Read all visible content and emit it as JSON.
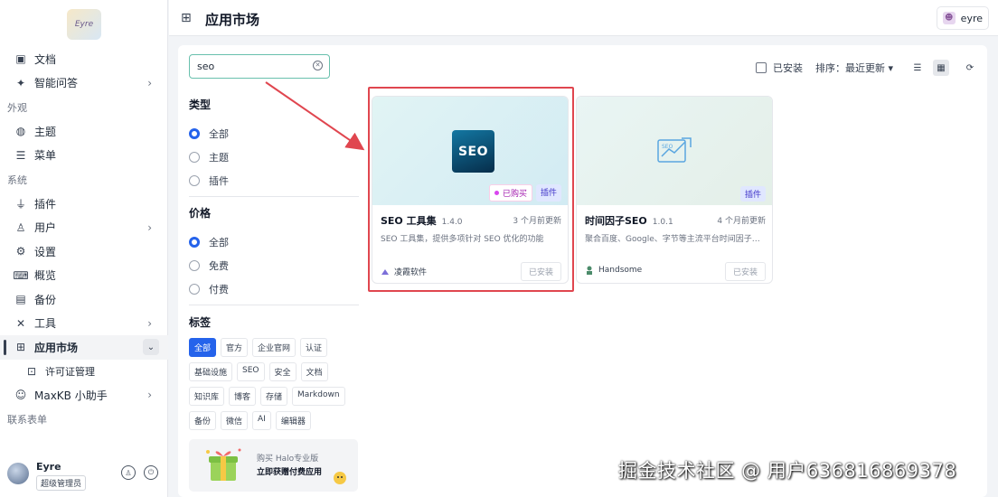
{
  "sidebar": {
    "logo_text": "Eyre",
    "items": [
      {
        "label": "文档",
        "icon": "doc-icon"
      },
      {
        "label": "智能问答",
        "icon": "sparkle-icon",
        "arrow": true
      }
    ],
    "group_appearance": "外观",
    "appearance_items": [
      {
        "label": "主题",
        "icon": "palette-icon"
      },
      {
        "label": "菜单",
        "icon": "menu-icon"
      }
    ],
    "group_system": "系统",
    "system_items": [
      {
        "label": "插件",
        "icon": "plug-icon"
      },
      {
        "label": "用户",
        "icon": "user-icon",
        "arrow": true
      },
      {
        "label": "设置",
        "icon": "gear-icon"
      },
      {
        "label": "概览",
        "icon": "terminal-icon"
      },
      {
        "label": "备份",
        "icon": "backup-icon"
      },
      {
        "label": "工具",
        "icon": "tools-icon",
        "arrow": true
      },
      {
        "label": "应用市场",
        "icon": "apps-icon",
        "active": true
      },
      {
        "label": "许可证管理",
        "icon": "license-icon",
        "sub": true
      },
      {
        "label": "MaxKB 小助手",
        "icon": "bot-icon",
        "arrow": true
      }
    ],
    "group_forms": "联系表单",
    "user": {
      "name": "Eyre",
      "role": "超级管理员"
    }
  },
  "header": {
    "title": "应用市场",
    "account": "eyre"
  },
  "search": {
    "value": "seo"
  },
  "filters": {
    "type": {
      "title": "类型",
      "options": [
        "全部",
        "主题",
        "插件"
      ],
      "selected": "全部"
    },
    "price": {
      "title": "价格",
      "options": [
        "全部",
        "免费",
        "付费"
      ],
      "selected": "全部"
    },
    "tags": {
      "title": "标签",
      "items": [
        "全部",
        "官方",
        "企业官网",
        "认证",
        "基础设施",
        "SEO",
        "安全",
        "文档",
        "知识库",
        "博客",
        "存储",
        "Markdown",
        "备份",
        "微信",
        "AI",
        "编辑器"
      ],
      "selected": "全部"
    }
  },
  "promo": {
    "line1": "购买 Halo专业版",
    "line2": "立即获赠付费应用"
  },
  "toolbar": {
    "installed_label": "已安装",
    "sort_label": "排序：最近更新"
  },
  "cards": [
    {
      "name": "SEO 工具集",
      "version": "1.4.0",
      "updated": "3 个月前更新",
      "desc": "SEO 工具集，提供多项针对 SEO 优化的功能",
      "author": "凌霞软件",
      "install": "已安装",
      "bought": "已购买",
      "type": "插件",
      "logo": "SEO"
    },
    {
      "name": "时间因子SEO",
      "version": "1.0.1",
      "updated": "4 个月前更新",
      "desc": "聚合百度、Google、字节等主流平台时间因子和元...",
      "author": "Handsome",
      "install": "已安装",
      "type": "插件"
    }
  ],
  "watermark": "掘金技术社区 @ 用户636816869378",
  "colors": {
    "accent": "#2563eb",
    "highlight": "#e0464f",
    "search_border": "#69c0ad"
  }
}
